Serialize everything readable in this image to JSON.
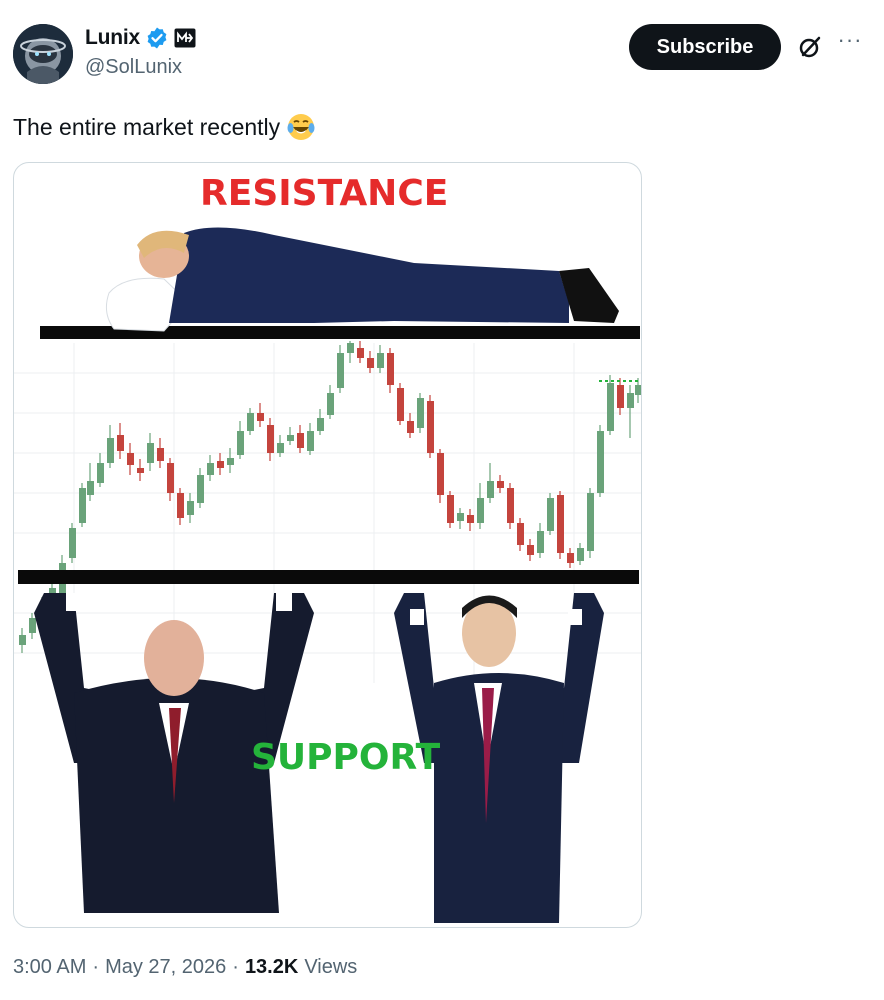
{
  "author": {
    "display_name": "Lunix",
    "handle": "@SolLunix",
    "avatar_icon": "astronaut-avatar",
    "verified_color": "#1d9bf0"
  },
  "actions": {
    "subscribe_label": "Subscribe",
    "grok_icon": "slashed-circle-icon",
    "more_label": "···"
  },
  "tweet": {
    "text": "The entire market recently",
    "emoji": "face-with-tears-of-joy"
  },
  "media": {
    "top_label": "RESISTANCE",
    "bottom_label": "SUPPORT",
    "top_label_color": "#e52b2b",
    "bottom_label_color": "#24b33a",
    "candle_up_color": "#6aa37a",
    "candle_down_color": "#c4443d"
  },
  "meta": {
    "time": "3:00 AM",
    "separator": "·",
    "date": "May 27, 2026",
    "views_count": "13.2K",
    "views_label": "Views"
  }
}
